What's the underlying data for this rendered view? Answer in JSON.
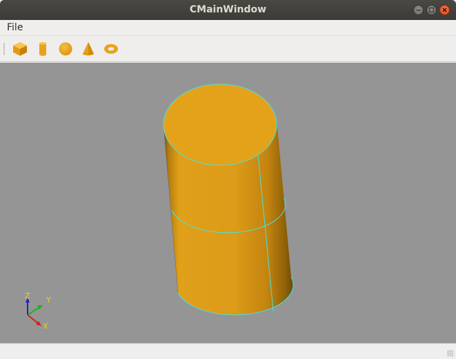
{
  "window": {
    "title": "CMainWindow"
  },
  "menubar": {
    "items": [
      {
        "label": "File"
      }
    ]
  },
  "toolbar": {
    "tools": [
      {
        "name": "box-icon"
      },
      {
        "name": "cylinder-icon"
      },
      {
        "name": "sphere-icon"
      },
      {
        "name": "cone-icon"
      },
      {
        "name": "torus-icon"
      }
    ]
  },
  "viewport": {
    "background_color": "#959595",
    "shape_color": "#e4a21a",
    "edge_color": "#3ee6e6",
    "axes": {
      "z_label": "Z",
      "y_label": "Y",
      "x_label": "X",
      "label_color": "#e8d020"
    }
  }
}
